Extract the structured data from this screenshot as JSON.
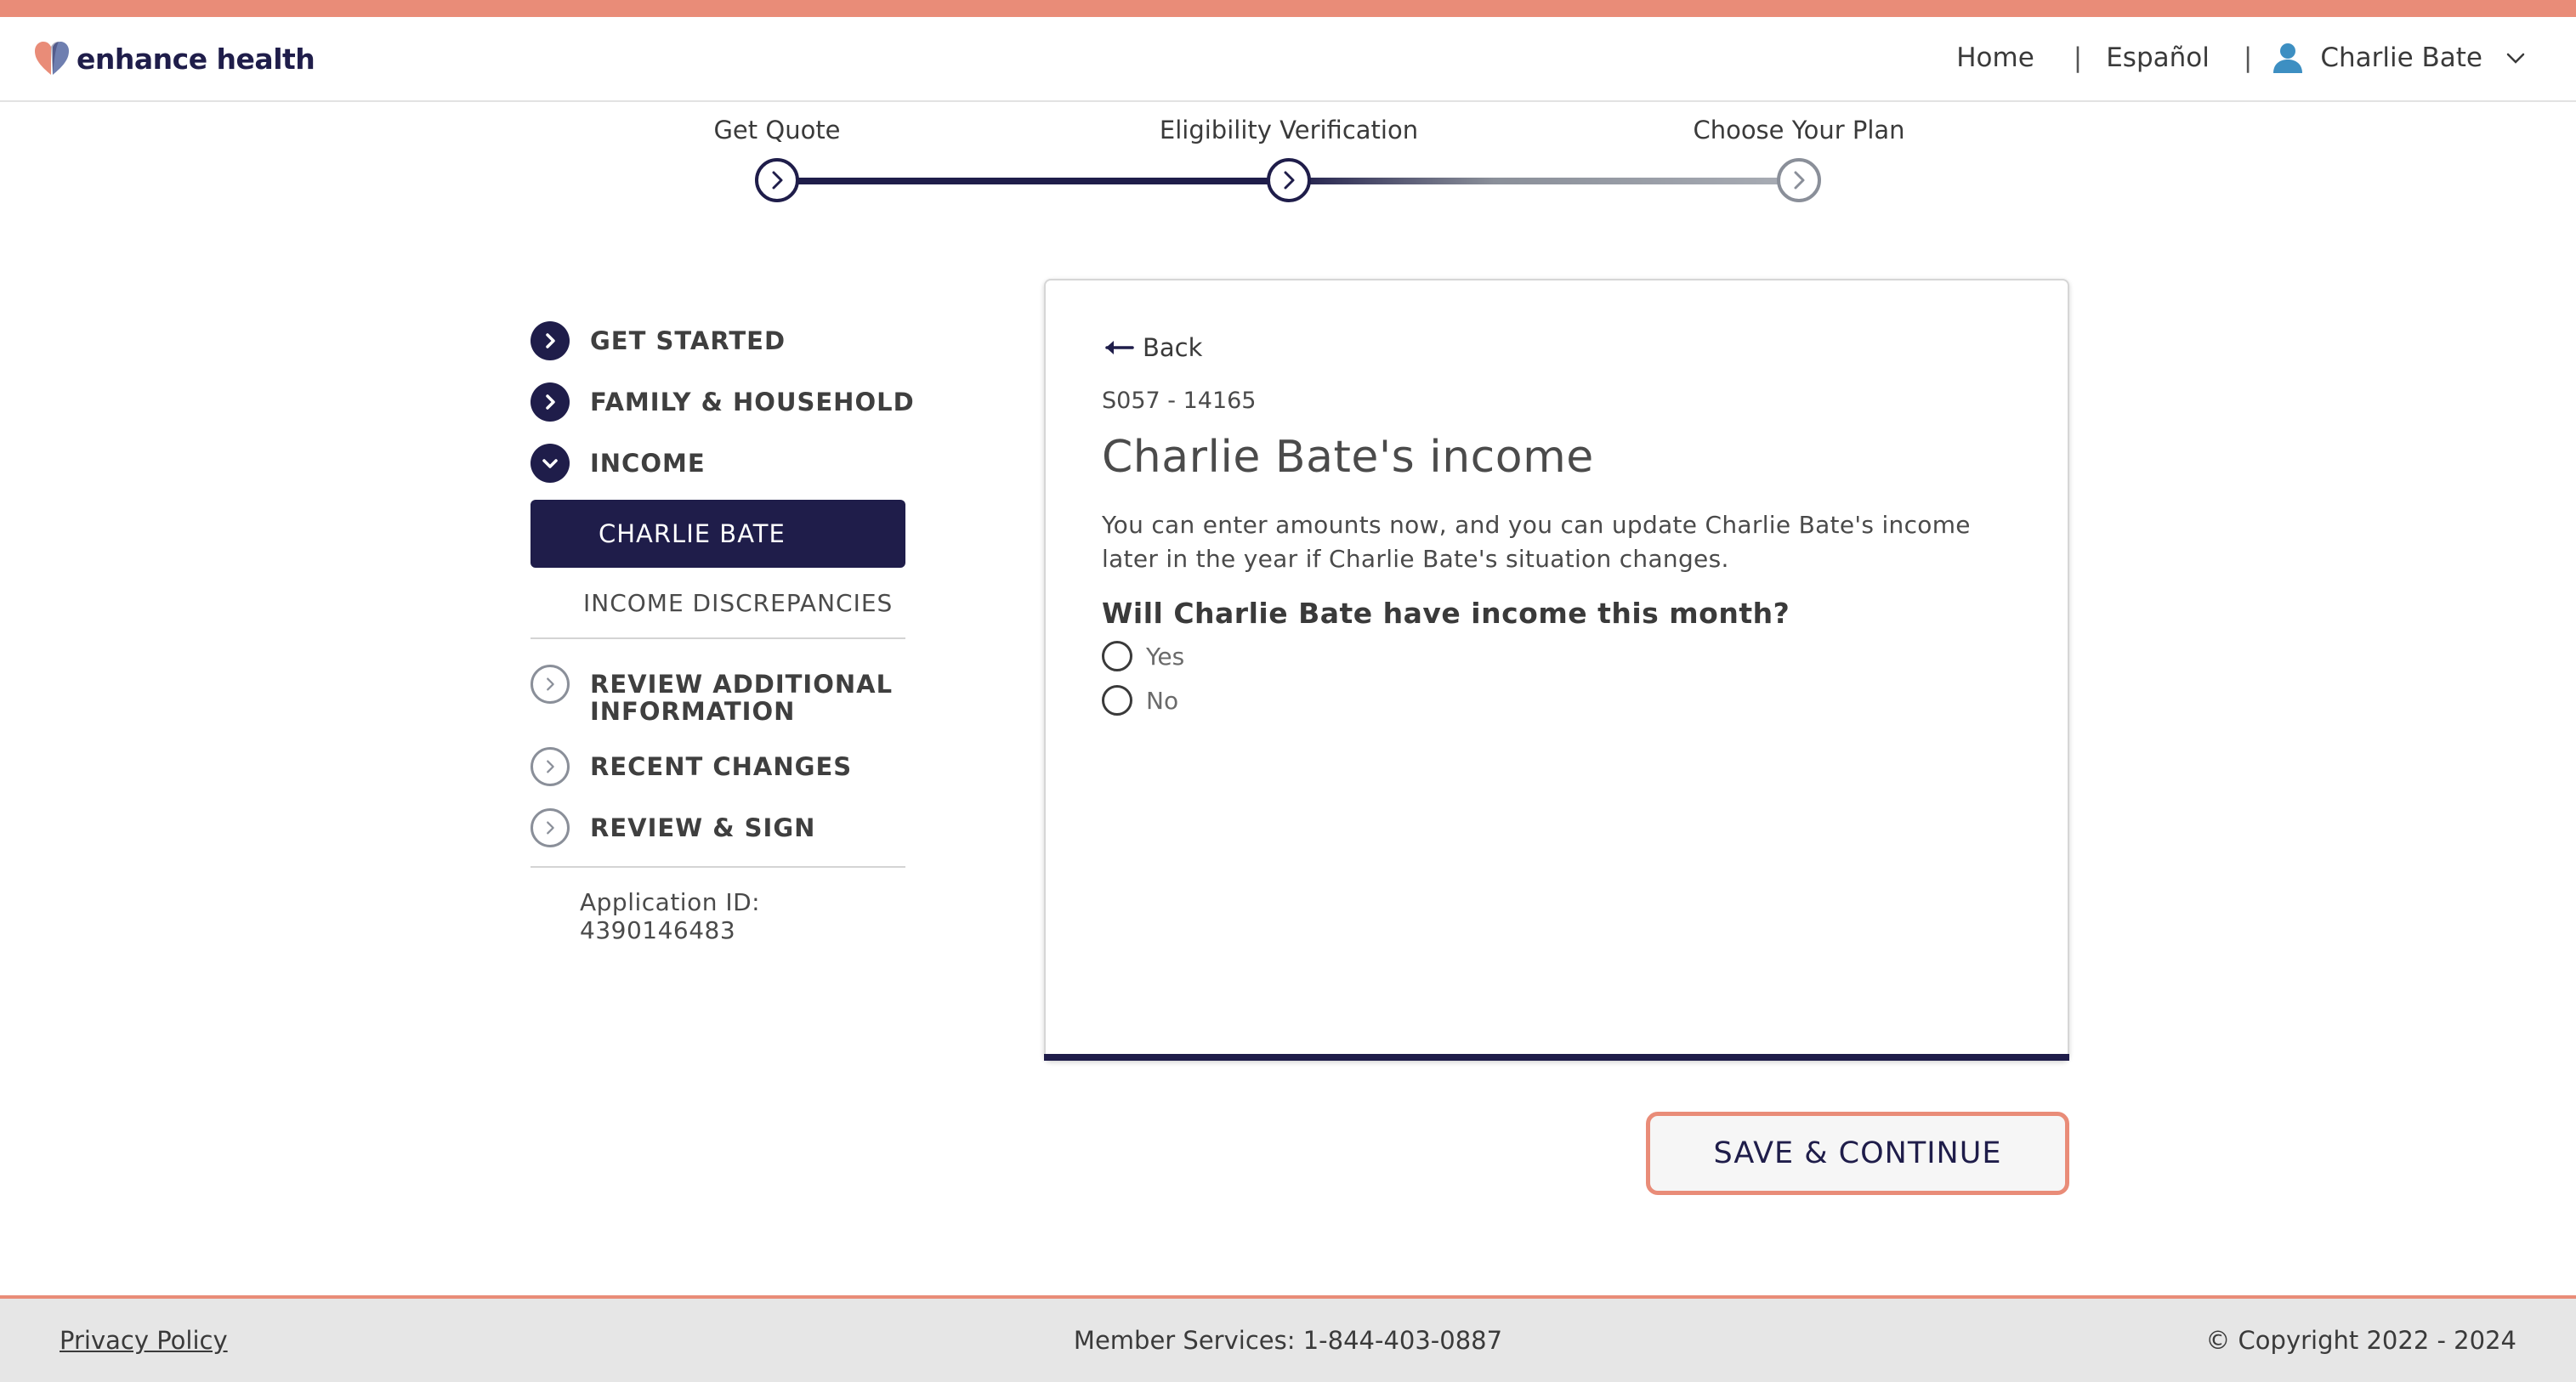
{
  "brand": {
    "name": "enhance health",
    "colors": {
      "navy": "#1f1d4a",
      "coral": "#e98c78",
      "gray": "#8a8f99"
    }
  },
  "nav": {
    "home": "Home",
    "separator": "|",
    "language": "Español",
    "user_name": "Charlie Bate"
  },
  "progress": {
    "steps": [
      {
        "label": "Get Quote",
        "status": "complete"
      },
      {
        "label": "Eligibility Verification",
        "status": "current"
      },
      {
        "label": "Choose Your Plan",
        "status": "upcoming"
      }
    ]
  },
  "sidebar": {
    "items": [
      {
        "label": "GET STARTED",
        "state": "complete"
      },
      {
        "label": "FAMILY & HOUSEHOLD",
        "state": "complete"
      },
      {
        "label": "INCOME",
        "state": "expanded"
      },
      {
        "label": "REVIEW ADDITIONAL INFORMATION",
        "state": "upcoming"
      },
      {
        "label": "RECENT CHANGES",
        "state": "upcoming"
      },
      {
        "label": "REVIEW & SIGN",
        "state": "upcoming"
      }
    ],
    "income_subitems": [
      {
        "label": "CHARLIE BATE",
        "active": true
      },
      {
        "label": "INCOME DISCREPANCIES",
        "active": false
      }
    ],
    "application_id": "Application ID: 4390146483"
  },
  "card": {
    "back_label": "Back",
    "case_id": "S057 - 14165",
    "title": "Charlie Bate's income",
    "description": "You can enter amounts now, and you can update Charlie Bate's income later in the year if Charlie Bate's situation changes.",
    "question": "Will Charlie Bate have income this month?",
    "options": [
      "Yes",
      "No"
    ]
  },
  "actions": {
    "save_continue": "SAVE & CONTINUE"
  },
  "footer": {
    "privacy": "Privacy Policy",
    "member_services": "Member Services: 1-844-403-0887",
    "copyright": "© Copyright 2022 - 2024"
  }
}
